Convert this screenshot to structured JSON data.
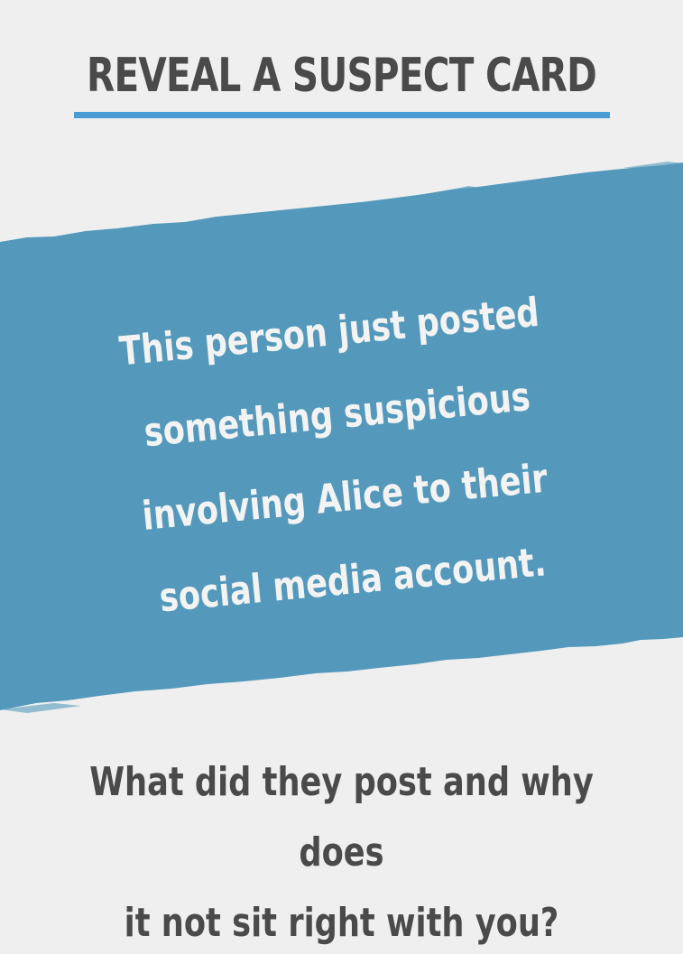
{
  "card": {
    "title": "REVEAL A SUSPECT CARD",
    "clue_lines": [
      "This person just posted",
      "something suspicious",
      "involving Alice to their",
      "social media account."
    ],
    "prompt_lines": [
      "What did they post and why does",
      "it not sit right with you?"
    ]
  },
  "colors": {
    "background": "#efefef",
    "banner": "#5499bb",
    "accent": "#4b9cd3",
    "title_text": "#4a4a4a",
    "clue_text": "#f3f3f3"
  }
}
